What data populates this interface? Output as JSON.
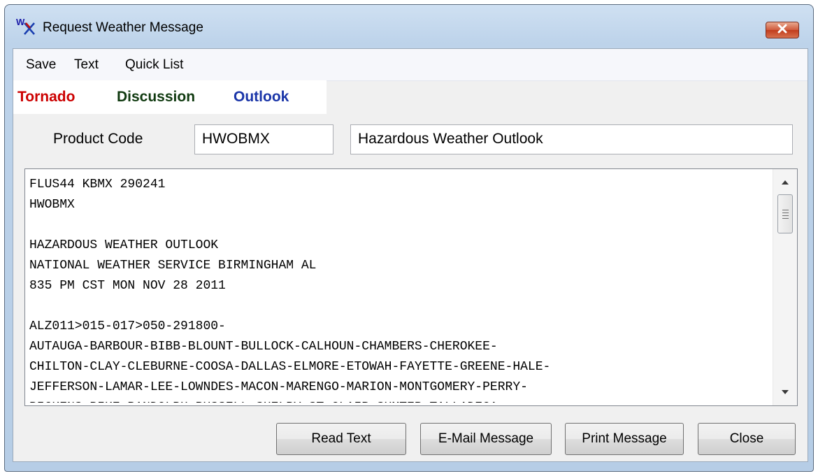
{
  "window": {
    "title": "Request Weather Message",
    "app_icon": "wx-icon",
    "close_icon": "close-icon"
  },
  "menu": [
    {
      "label": "Save"
    },
    {
      "label": "Text"
    },
    {
      "label": "Quick List"
    }
  ],
  "tabs": [
    {
      "label": "Tornado",
      "color": "#cc0000"
    },
    {
      "label": "Discussion",
      "color": "#103a10"
    },
    {
      "label": "Outlook",
      "color": "#1a35a8"
    }
  ],
  "product": {
    "code_label": "Product Code",
    "code_value": "HWOBMX",
    "description": "Hazardous Weather Outlook"
  },
  "message_text": "FLUS44 KBMX 290241\nHWOBMX\n\nHAZARDOUS WEATHER OUTLOOK\nNATIONAL WEATHER SERVICE BIRMINGHAM AL\n835 PM CST MON NOV 28 2011\n\nALZ011>015-017>050-291800-\nAUTAUGA-BARBOUR-BIBB-BLOUNT-BULLOCK-CALHOUN-CHAMBERS-CHEROKEE-\nCHILTON-CLAY-CLEBURNE-COOSA-DALLAS-ELMORE-ETOWAH-FAYETTE-GREENE-HALE-\nJEFFERSON-LAMAR-LEE-LOWNDES-MACON-MARENGO-MARION-MONTGOMERY-PERRY-\nPICKENS-PIKE-RANDOLPH-RUSSELL-SHELBY-ST CLAIR-SUMTER-TALLADEGA-",
  "buttons": {
    "read_text": "Read Text",
    "email": "E-Mail Message",
    "print": "Print Message",
    "close": "Close"
  }
}
